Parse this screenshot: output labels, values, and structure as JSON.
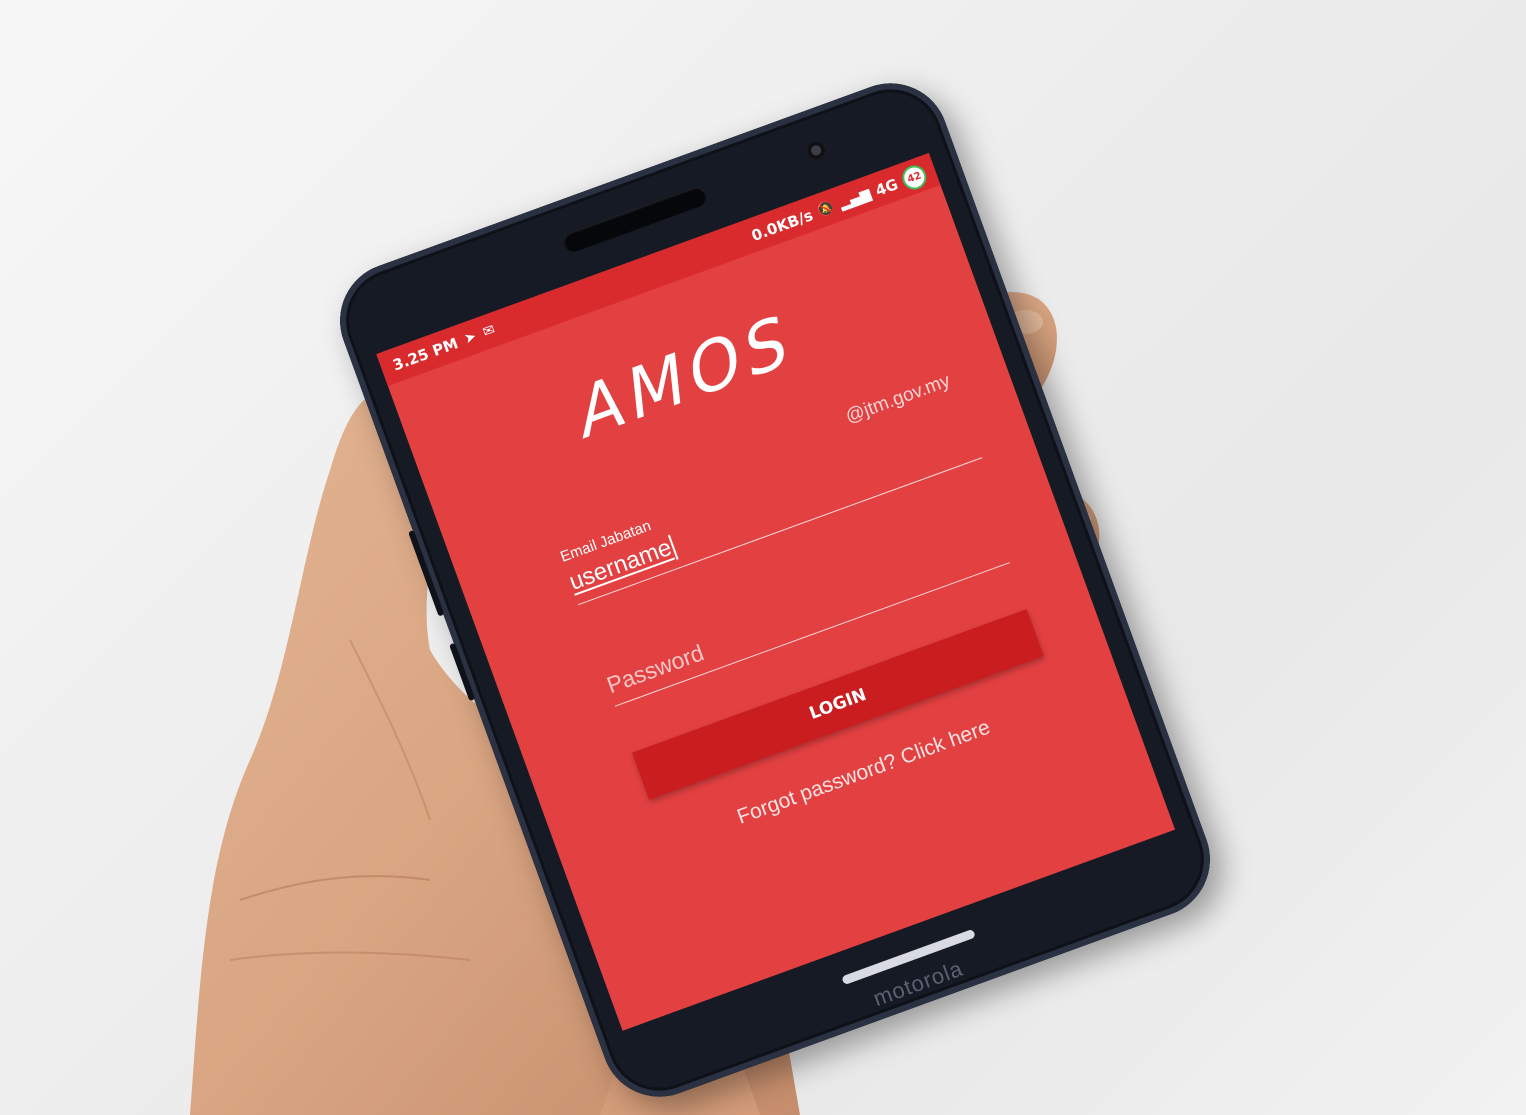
{
  "status_bar": {
    "time": "3.25 PM",
    "left_icons": [
      "telegram-icon",
      "mail-icon"
    ],
    "speed": "0.0KB/s",
    "network": "4G",
    "battery": "42"
  },
  "app": {
    "logo": "AMOS"
  },
  "login_form": {
    "domain_hint": "@jtm.gov.my",
    "email_label": "Email Jabatan",
    "email_value": "username",
    "password_placeholder": "Password",
    "login_button": "LOGIN",
    "forgot_link": "Forgot password? Click here"
  },
  "device": {
    "brand": "motorola"
  },
  "colors": {
    "app_background": "#e24041",
    "status_bar": "#d92b2d",
    "button": "#c91d20",
    "text": "#ffffff"
  }
}
